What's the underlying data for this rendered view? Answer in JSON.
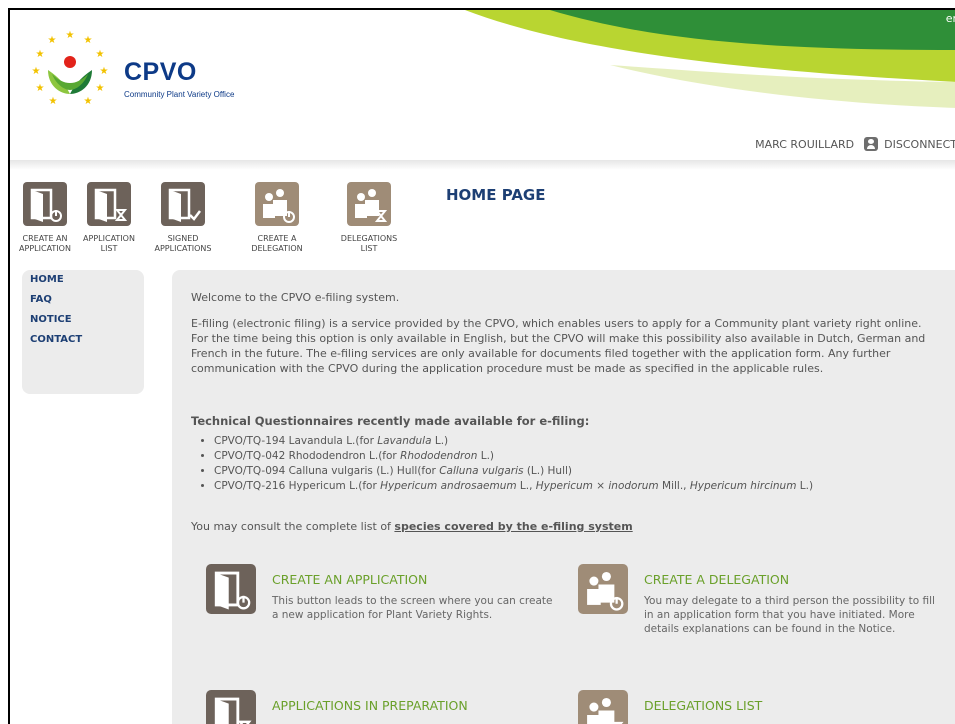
{
  "header": {
    "lang": "er",
    "brand": "CPVO",
    "brand_sub": "Community Plant Variety Office",
    "user": "MARC ROUILLARD",
    "disconnect": "DISCONNECT"
  },
  "toolbar": [
    {
      "line1": "CREATE AN",
      "line2": "APPLICATION",
      "icon": "create-application-icon"
    },
    {
      "line1": "APPLICATION",
      "line2": "LIST",
      "icon": "application-list-icon"
    },
    {
      "line1": "SIGNED",
      "line2": "APPLICATIONS",
      "icon": "signed-applications-icon"
    },
    {
      "line1": "CREATE A",
      "line2": "DELEGATION",
      "icon": "create-delegation-icon"
    },
    {
      "line1": "DELEGATIONS",
      "line2": "LIST",
      "icon": "delegations-list-icon"
    }
  ],
  "page_title": "HOME PAGE",
  "nav": [
    "HOME",
    "FAQ",
    "NOTICE",
    "CONTACT"
  ],
  "content": {
    "welcome": "Welcome to the CPVO e-filing system.",
    "intro": "E-filing (electronic filing) is a service provided by the CPVO, which enables users to apply for a Community plant variety right online. For the time being this option is only available in English, but the CPVO will make this possibility also available in Dutch, German and French in the future. The e-filing services are only available for documents filed together with the application form. Any further communication with the CPVO during the application procedure must be made as specified in the applicable rules.",
    "tq_heading": "Technical Questionnaires recently made available for e-filing:",
    "tq": [
      {
        "code": "CPVO/TQ-194 Lavandula L.",
        "for_prefix": "(for ",
        "italic1": "Lavandula",
        "rest1": " L.)",
        "italic2": "",
        "rest2": "",
        "italic3": "",
        "rest3": ""
      },
      {
        "code": "CPVO/TQ-042 Rhododendron L.",
        "for_prefix": "(for ",
        "italic1": "Rhododendron",
        "rest1": " L.)",
        "italic2": "",
        "rest2": "",
        "italic3": "",
        "rest3": ""
      },
      {
        "code": "CPVO/TQ-094 Calluna vulgaris (L.) Hull",
        "for_prefix": "(for ",
        "italic1": "Calluna vulgaris",
        "rest1": " (L.) Hull)",
        "italic2": "",
        "rest2": "",
        "italic3": "",
        "rest3": ""
      },
      {
        "code": "CPVO/TQ-216 Hypericum L.",
        "for_prefix": "(for ",
        "italic1": "Hypericum androsaemum",
        "rest1": " L., ",
        "italic2": "Hypericum × inodorum",
        "rest2": " Mill., ",
        "italic3": "Hypericum hircinum",
        "rest3": " L.)"
      }
    ],
    "consult_prefix": "You may consult the complete list of ",
    "consult_link": "species covered by the e-filing system"
  },
  "features": [
    {
      "title": "CREATE AN APPLICATION",
      "desc": "This button leads to the screen where you can create a new application for Plant Variety Rights."
    },
    {
      "title": "CREATE A DELEGATION",
      "desc": "You may delegate to a third person the possibility to fill in an application form that you have initiated. More details explanations can be found in the Notice."
    },
    {
      "title": "APPLICATIONS IN PREPARATION",
      "desc": ""
    },
    {
      "title": "DELEGATIONS LIST",
      "desc": ""
    }
  ],
  "colors": {
    "brand_blue": "#0d3a87",
    "title_blue": "#1d3f74",
    "green": "#6aa02a",
    "icon_dark": "#6d625a",
    "icon_light": "#9f8c77"
  }
}
